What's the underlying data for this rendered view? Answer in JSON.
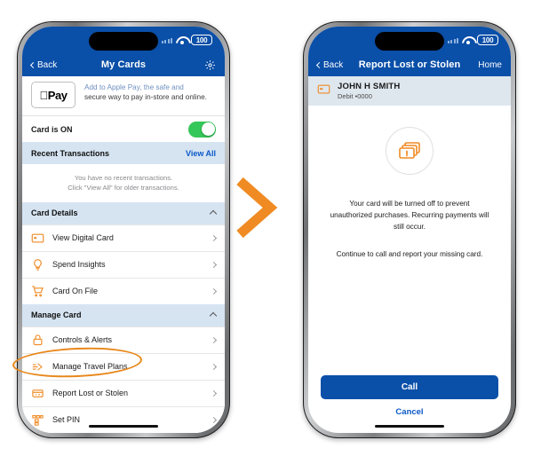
{
  "left_phone": {
    "status_bar": {
      "battery": "100",
      "wifi_icon": "wifi-icon",
      "signal_icon": "signal-icon"
    },
    "nav": {
      "back": "Back",
      "title": "My Cards",
      "settings_icon": "gear-icon"
    },
    "apple_pay": {
      "badge": "Pay",
      "text_clipped": "Add to Apple Pay, the safe and",
      "text": "secure way to pay in-store and online."
    },
    "card_toggle": {
      "label": "Card is ON",
      "state": "on"
    },
    "recent_transactions": {
      "title": "Recent Transactions",
      "view_all": "View All",
      "empty_line1": "You have no recent transactions.",
      "empty_line2": "Click \"View All\" for older transactions."
    },
    "card_details": {
      "title": "Card Details",
      "items": [
        {
          "label": "View Digital Card",
          "icon": "card-icon"
        },
        {
          "label": "Spend Insights",
          "icon": "lightbulb-icon"
        },
        {
          "label": "Card On File",
          "icon": "shopping-cart-icon"
        }
      ]
    },
    "manage_card": {
      "title": "Manage Card",
      "items": [
        {
          "label": "Controls & Alerts",
          "icon": "lock-icon"
        },
        {
          "label": "Manage Travel Plans",
          "icon": "airplane-icon"
        },
        {
          "label": "Report Lost or Stolen",
          "icon": "card-alert-icon"
        },
        {
          "label": "Set PIN",
          "icon": "keypad-icon"
        }
      ]
    }
  },
  "right_phone": {
    "status_bar": {
      "battery": "100",
      "wifi_icon": "wifi-icon",
      "signal_icon": "signal-icon"
    },
    "nav": {
      "back": "Back",
      "title": "Report Lost or Stolen",
      "home": "Home"
    },
    "card_holder": {
      "name": "JOHN H SMITH",
      "details": "Debit  •0000",
      "icon": "card-icon"
    },
    "alert_icon": "cards-exclamation-icon",
    "message_1": "Your card will be turned off to prevent unauthorized purchases. Recurring payments will still occur.",
    "message_2": "Continue to call and report your missing card.",
    "call_button": "Call",
    "cancel_button": "Cancel"
  },
  "annotations": {
    "highlight_target": "Report Lost or Stolen",
    "arrow_icon": "chevron-right-arrow",
    "accent_color": "#e8871a"
  }
}
